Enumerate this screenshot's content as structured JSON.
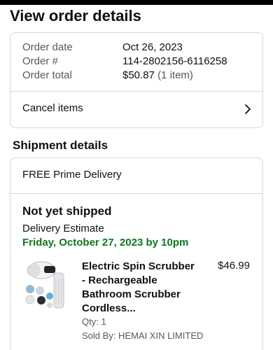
{
  "page": {
    "title": "View order details"
  },
  "order": {
    "rows": [
      {
        "label": "Order date",
        "value": "Oct 26, 2023"
      },
      {
        "label": "Order #",
        "value": "114-2802156-6116258"
      },
      {
        "label": "Order total",
        "value": "$50.87",
        "extra": "(1 item)"
      }
    ],
    "cancel_label": "Cancel items"
  },
  "shipment": {
    "section_title": "Shipment details",
    "delivery_type": "FREE Prime Delivery",
    "status": "Not yet shipped",
    "estimate_label": "Delivery Estimate",
    "estimate_date": "Friday, October 27, 2023 by 10pm",
    "item": {
      "name_lines": [
        "Electric Spin Scrubber",
        "- Rechargeable",
        "Bathroom Scrubber",
        "Cordless..."
      ],
      "price": "$46.99",
      "qty": "Qty: 1",
      "seller": "Sold By: HEMAI XIN LIMITED"
    }
  },
  "colors": {
    "delivery_green": "#067d17",
    "border": "#d5d9d9",
    "muted": "#565959"
  },
  "icons": {
    "cancel_chevron": "chevron-right-icon",
    "product_image": "product-thumbnail"
  }
}
